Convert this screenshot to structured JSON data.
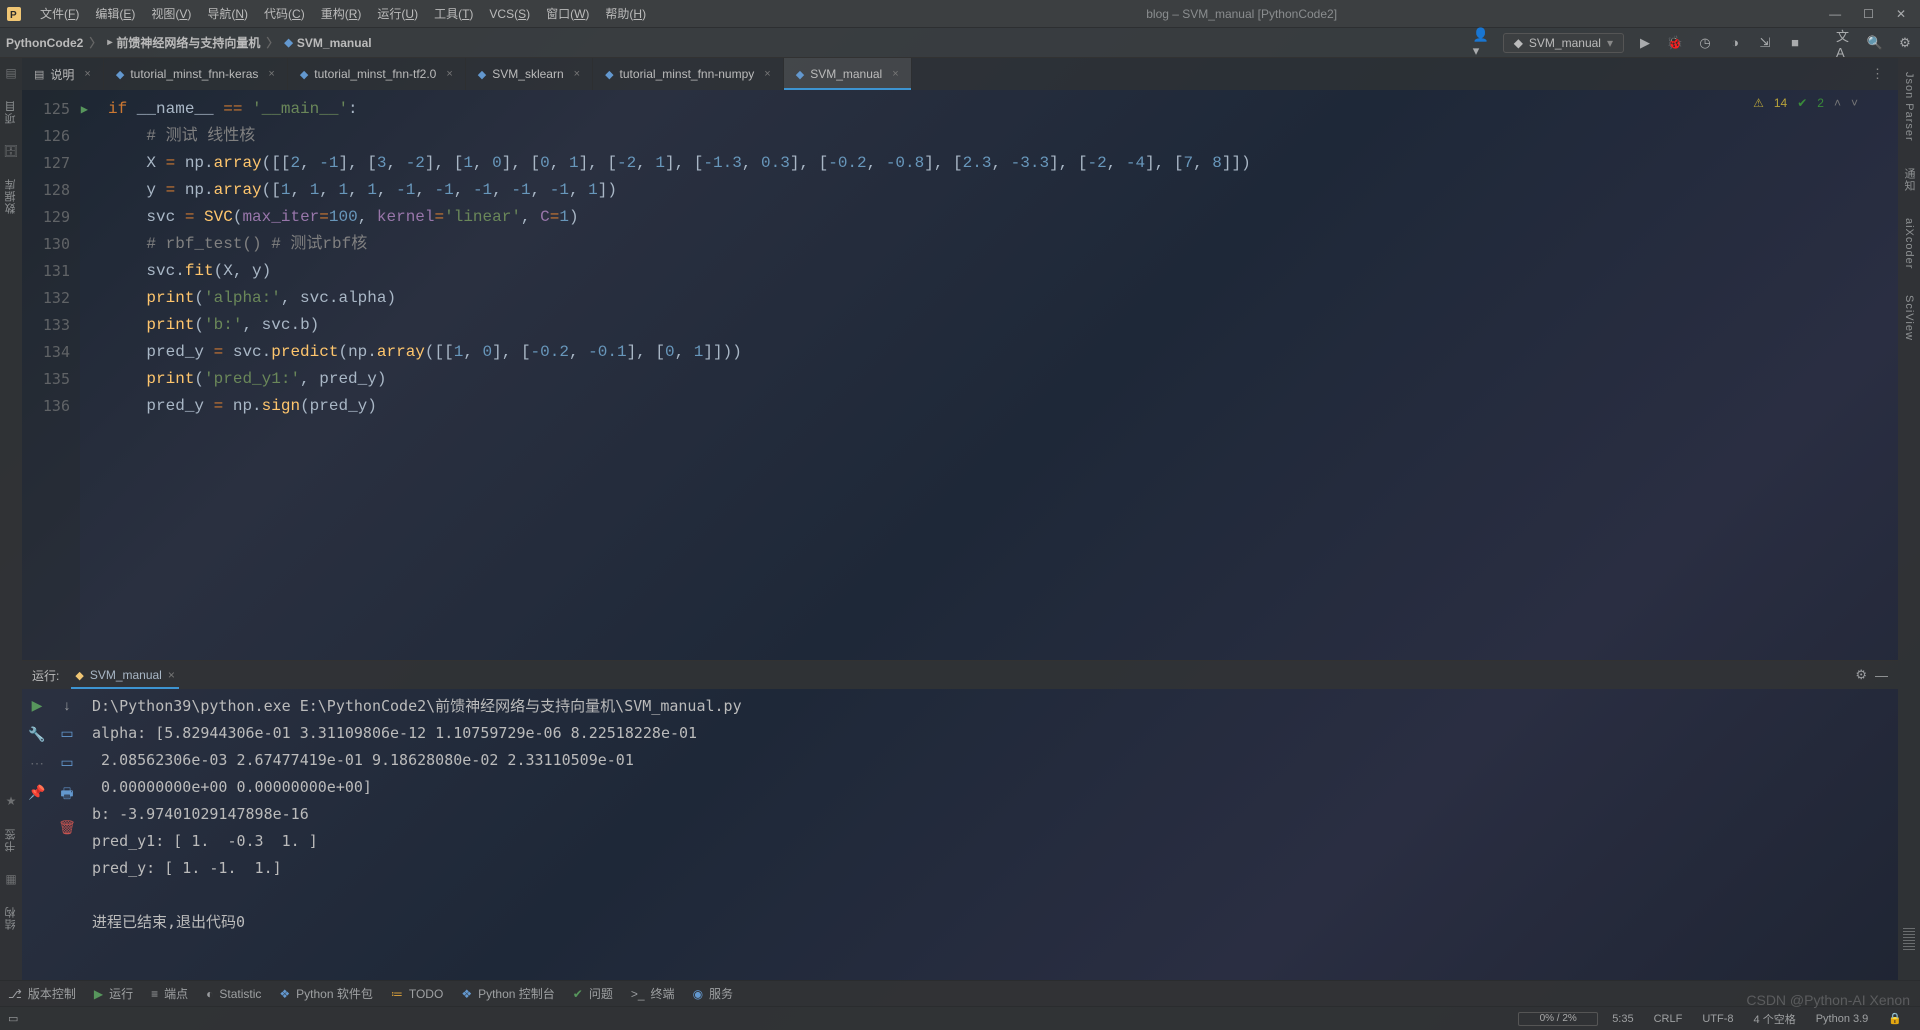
{
  "menubar": {
    "items": [
      "文件(F)",
      "编辑(E)",
      "视图(V)",
      "导航(N)",
      "代码(C)",
      "重构(R)",
      "运行(U)",
      "工具(T)",
      "VCS(S)",
      "窗口(W)",
      "帮助(H)"
    ],
    "title": "blog – SVM_manual [PythonCode2]"
  },
  "breadcrumb": {
    "parts": [
      "PythonCode2",
      "前馈神经网络与支持向量机",
      "SVM_manual"
    ]
  },
  "run_config": {
    "label": "SVM_manual"
  },
  "left_rail": {
    "labels": [
      "项目",
      "数据库",
      "书签",
      "结构"
    ]
  },
  "right_rail": {
    "labels": [
      "Json Parser",
      "通知",
      "aiXcoder",
      "SciView"
    ]
  },
  "tabs": {
    "items": [
      {
        "label": "说明",
        "icon": "▤"
      },
      {
        "label": "tutorial_minst_fnn-keras",
        "icon": "py"
      },
      {
        "label": "tutorial_minst_fnn-tf2.0",
        "icon": "py"
      },
      {
        "label": "SVM_sklearn",
        "icon": "py"
      },
      {
        "label": "tutorial_minst_fnn-numpy",
        "icon": "py"
      },
      {
        "label": "SVM_manual",
        "icon": "py",
        "active": true
      }
    ]
  },
  "gutter": {
    "start": 125,
    "end": 136
  },
  "inspection": {
    "warn_icon": "⚠",
    "warn": "14",
    "ok_icon": "✔",
    "ok": "2"
  },
  "code_lines": [
    {
      "t": "kw",
      "s": "if"
    },
    {
      "t": "line1",
      "s": "if __name__ == '__main__':"
    }
  ],
  "code_html": "<span class='kw'>if</span> __name__ <span class='kw'>==</span> <span class='str'>'__main__'</span><span class='op'>:</span>\n    <span class='cm'># 测试 线性核</span>\n    X <span class='kw'>=</span> np<span class='op'>.</span><span class='fn'>array</span><span class='par'>(</span>[[<span class='num'>2</span>, <span class='num'>-1</span>], [<span class='num'>3</span>, <span class='num'>-2</span>], [<span class='num'>1</span>, <span class='num'>0</span>], [<span class='num'>0</span>, <span class='num'>1</span>], [<span class='num'>-2</span>, <span class='num'>1</span>], [<span class='num'>-1.3</span>, <span class='num'>0.3</span>], [<span class='num'>-0.2</span>, <span class='num'>-0.8</span>], [<span class='num'>2.3</span>, <span class='num'>-3.3</span>], [<span class='num'>-2</span>, <span class='num'>-4</span>], [<span class='num'>7</span>, <span class='num'>8</span>]]<span class='par'>)</span>\n    y <span class='kw'>=</span> np<span class='op'>.</span><span class='fn'>array</span><span class='par'>(</span>[<span class='num'>1</span>, <span class='num'>1</span>, <span class='num'>1</span>, <span class='num'>1</span>, <span class='num'>-1</span>, <span class='num'>-1</span>, <span class='num'>-1</span>, <span class='num'>-1</span>, <span class='num'>-1</span>, <span class='num'>1</span>]<span class='par'>)</span>\n    svc <span class='kw'>=</span> <span class='fn'>SVC</span><span class='par'>(</span><span class='var'>max_iter</span><span class='kw'>=</span><span class='num'>100</span>, <span class='var'>kernel</span><span class='kw'>=</span><span class='str'>'linear'</span>, <span class='var'>C</span><span class='kw'>=</span><span class='num'>1</span><span class='par'>)</span>\n    <span class='cm'># rbf_test() # 测试rbf核</span>\n    svc<span class='op'>.</span><span class='fn'>fit</span><span class='par'>(</span>X, y<span class='par'>)</span>\n    <span class='fn'>print</span><span class='par'>(</span><span class='str'>'alpha:'</span>, svc<span class='op'>.</span>alpha<span class='par'>)</span>\n    <span class='fn'>print</span><span class='par'>(</span><span class='str'>'b:'</span>, svc<span class='op'>.</span>b<span class='par'>)</span>\n    pred_y <span class='kw'>=</span> svc<span class='op'>.</span><span class='fn'>predict</span><span class='par'>(</span>np<span class='op'>.</span><span class='fn'>array</span><span class='par'>(</span>[[<span class='num'>1</span>, <span class='num'>0</span>], [<span class='num'>-0.2</span>, <span class='num'>-0.1</span>], [<span class='num'>0</span>, <span class='num'>1</span>]]<span class='par'>))</span>\n    <span class='fn'>print</span><span class='par'>(</span><span class='str'>'pred_y1:'</span>, pred_y<span class='par'>)</span>\n    pred_y <span class='kw'>=</span> np<span class='op'>.</span><span class='fn'>sign</span><span class='par'>(</span>pred_y<span class='par'>)</span>",
  "run_panel": {
    "title": "运行:",
    "tab": "SVM_manual",
    "output": "D:\\Python39\\python.exe E:\\PythonCode2\\前馈神经网络与支持向量机\\SVM_manual.py\nalpha: [5.82944306e-01 3.31109806e-12 1.10759729e-06 8.22518228e-01\n 2.08562306e-03 2.67477419e-01 9.18628080e-02 2.33110509e-01\n 0.00000000e+00 0.00000000e+00]\nb: -3.97401029147898e-16\npred_y1: [ 1.  -0.3  1. ]\npred_y: [ 1. -1.  1.]\n\n进程已结束,退出代码0"
  },
  "bottom_tools": {
    "items": [
      {
        "icon": "⎇",
        "label": "版本控制",
        "cls": "grey"
      },
      {
        "icon": "▶",
        "label": "运行",
        "cls": "green-caret"
      },
      {
        "icon": "≡",
        "label": "端点",
        "cls": "grey"
      },
      {
        "icon": "◐",
        "label": "Statistic",
        "cls": "grey"
      },
      {
        "icon": "❖",
        "label": "Python 软件包",
        "cls": "blue"
      },
      {
        "icon": "≔",
        "label": "TODO",
        "cls": "orange"
      },
      {
        "icon": "❖",
        "label": "Python 控制台",
        "cls": "blue"
      },
      {
        "icon": "✔",
        "label": "问题",
        "cls": "green"
      },
      {
        "icon": ">_",
        "label": "终端",
        "cls": "grey"
      },
      {
        "icon": "◉",
        "label": "服务",
        "cls": "blue"
      }
    ]
  },
  "statusbar": {
    "meter": "0% / 2%",
    "caret": "5:35",
    "eol": "CRLF",
    "enc": "UTF-8",
    "indent": "4 个空格",
    "interp": "Python 3.9",
    "watermark": "CSDN @Python-AI Xenon"
  }
}
